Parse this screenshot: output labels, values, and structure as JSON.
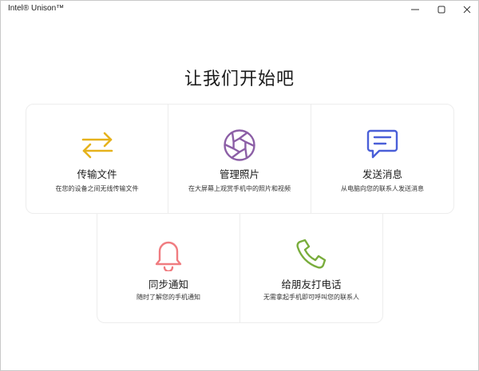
{
  "window": {
    "title": "Intel® Unison™"
  },
  "heading": "让我们开始吧",
  "cards": [
    {
      "title": "传输文件",
      "desc": "在您的设备之间无线传输文件",
      "icon": "transfer-arrows-icon",
      "color": "#e6b21c"
    },
    {
      "title": "管理照片",
      "desc": "在大屏幕上观赏手机中的照片和视频",
      "icon": "camera-aperture-icon",
      "color": "#8c5fa6"
    },
    {
      "title": "发送消息",
      "desc": "从电脑向您的联系人发送消息",
      "icon": "message-bubble-icon",
      "color": "#4a5fd8"
    },
    {
      "title": "同步通知",
      "desc": "随时了解您的手机通知",
      "icon": "bell-icon",
      "color": "#f07c80"
    },
    {
      "title": "给朋友打电话",
      "desc": "无需拿起手机即可呼叫您的联系人",
      "icon": "phone-icon",
      "color": "#79ad3c"
    }
  ]
}
